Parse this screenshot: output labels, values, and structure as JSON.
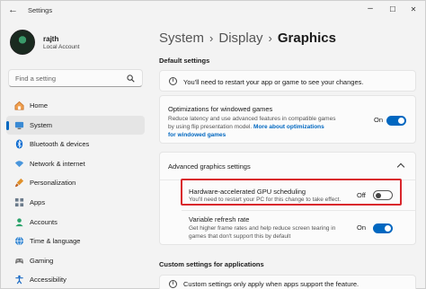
{
  "window": {
    "back_glyph": "←",
    "title": "Settings",
    "minimize_glyph": "–",
    "maximize_glyph": "☐",
    "close_glyph": "✕"
  },
  "user": {
    "name": "rajth",
    "account_type": "Local Account"
  },
  "search": {
    "placeholder": "Find a setting"
  },
  "sidebar": {
    "items": [
      {
        "label": "Home",
        "icon": "home-icon",
        "color": "#e07a2e",
        "active": false
      },
      {
        "label": "System",
        "icon": "monitor-icon",
        "color": "#0067c0",
        "active": true
      },
      {
        "label": "Bluetooth & devices",
        "icon": "bluetooth-icon",
        "color": "#0067c0",
        "active": false
      },
      {
        "label": "Network & internet",
        "icon": "wifi-icon",
        "color": "#3a8ad4",
        "active": false
      },
      {
        "label": "Personalization",
        "icon": "brush-icon",
        "color": "#d07830",
        "active": false
      },
      {
        "label": "Apps",
        "icon": "apps-icon",
        "color": "#5a6a7a",
        "active": false
      },
      {
        "label": "Accounts",
        "icon": "person-icon",
        "color": "#2aa26a",
        "active": false
      },
      {
        "label": "Time & language",
        "icon": "globe-icon",
        "color": "#2a7ad4",
        "active": false
      },
      {
        "label": "Gaming",
        "icon": "gamepad-icon",
        "color": "#6a6a6a",
        "active": false
      },
      {
        "label": "Accessibility",
        "icon": "accessibility-icon",
        "color": "#1a6ac4",
        "active": false
      }
    ]
  },
  "breadcrumb": {
    "items": [
      "System",
      "Display"
    ],
    "separator": "›",
    "current": "Graphics"
  },
  "default_settings": {
    "heading": "Default settings",
    "restart_notice": "You'll need to restart your app or game to see your changes."
  },
  "windowed_games": {
    "title": "Optimizations for windowed games",
    "desc_1": "Reduce latency and use advanced features in compatible games",
    "desc_2": "by using flip presentation model.",
    "link": "More about optimizations",
    "link_2": "for windowed games",
    "state_label": "On"
  },
  "advanced": {
    "heading": "Advanced graphics settings",
    "hags_title": "Hardware-accelerated GPU scheduling",
    "hags_desc": "You'll need to restart your PC for this change to take effect.",
    "hags_state": "Off",
    "vrr_title": "Variable refresh rate",
    "vrr_desc_1": "Get higher frame rates and help reduce screen tearing in",
    "vrr_desc_2": "games that don't support this by default",
    "vrr_state": "On"
  },
  "custom": {
    "heading": "Custom settings for applications",
    "notice": "Custom settings only apply when apps support the feature."
  },
  "accent_color": "#0067c0",
  "highlight_color": "#d9262c"
}
